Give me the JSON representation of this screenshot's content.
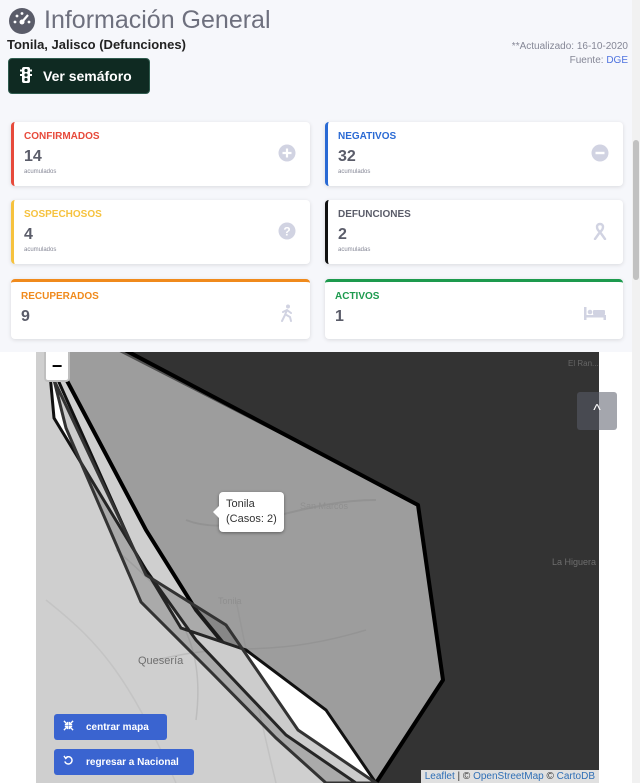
{
  "header": {
    "title": "Información General",
    "subtitle": "Tonila, Jalisco (Defunciones)",
    "updated": "**Actualizado: 16-10-2020",
    "fuente_label": "Fuente:",
    "fuente_value": "DGE",
    "semaforo_label": "Ver semáforo"
  },
  "cards": {
    "confirmados": {
      "label": "CONFIRMADOS",
      "value": "14",
      "sub": "acumulados",
      "color": "#e74a3b",
      "icon": "plus-circle-icon"
    },
    "negativos": {
      "label": "NEGATIVOS",
      "value": "32",
      "sub": "acumulados",
      "color": "#2a6ad4",
      "icon": "minus-circle-icon"
    },
    "sospechosos": {
      "label": "SOSPECHOSOS",
      "value": "4",
      "sub": "acumulados",
      "color": "#f6c23e",
      "icon": "question-circle-icon"
    },
    "defunciones": {
      "label": "DEFUNCIONES",
      "value": "2",
      "sub": "acumuladas",
      "color": "#333333",
      "icon": "ribbon-icon"
    },
    "recuperados": {
      "label": "RECUPERADOS",
      "value": "9",
      "color": "#f08a1c",
      "icon": "walking-icon"
    },
    "activos": {
      "label": "ACTIVOS",
      "value": "1",
      "color": "#1d9a4e",
      "icon": "bed-icon"
    }
  },
  "map": {
    "zoom_in": "+",
    "zoom_out": "−",
    "tooltip_name": "Tonila",
    "tooltip_cases": "(Casos: 2)",
    "places": {
      "san_marcos": "San Marcos",
      "tonila": "Tonila",
      "queseria": "Quesería",
      "la_higuera": "La Higuera",
      "small_top": "El Ran..."
    },
    "btn_centrar": "centrar mapa",
    "btn_regresar": "regresar a Nacional",
    "attribution": {
      "leaflet": "Leaflet",
      "sep1": " | © ",
      "osm": "OpenStreetMap",
      "sep2": " © ",
      "carto": "CartoDB"
    },
    "scroll_top": "^"
  }
}
